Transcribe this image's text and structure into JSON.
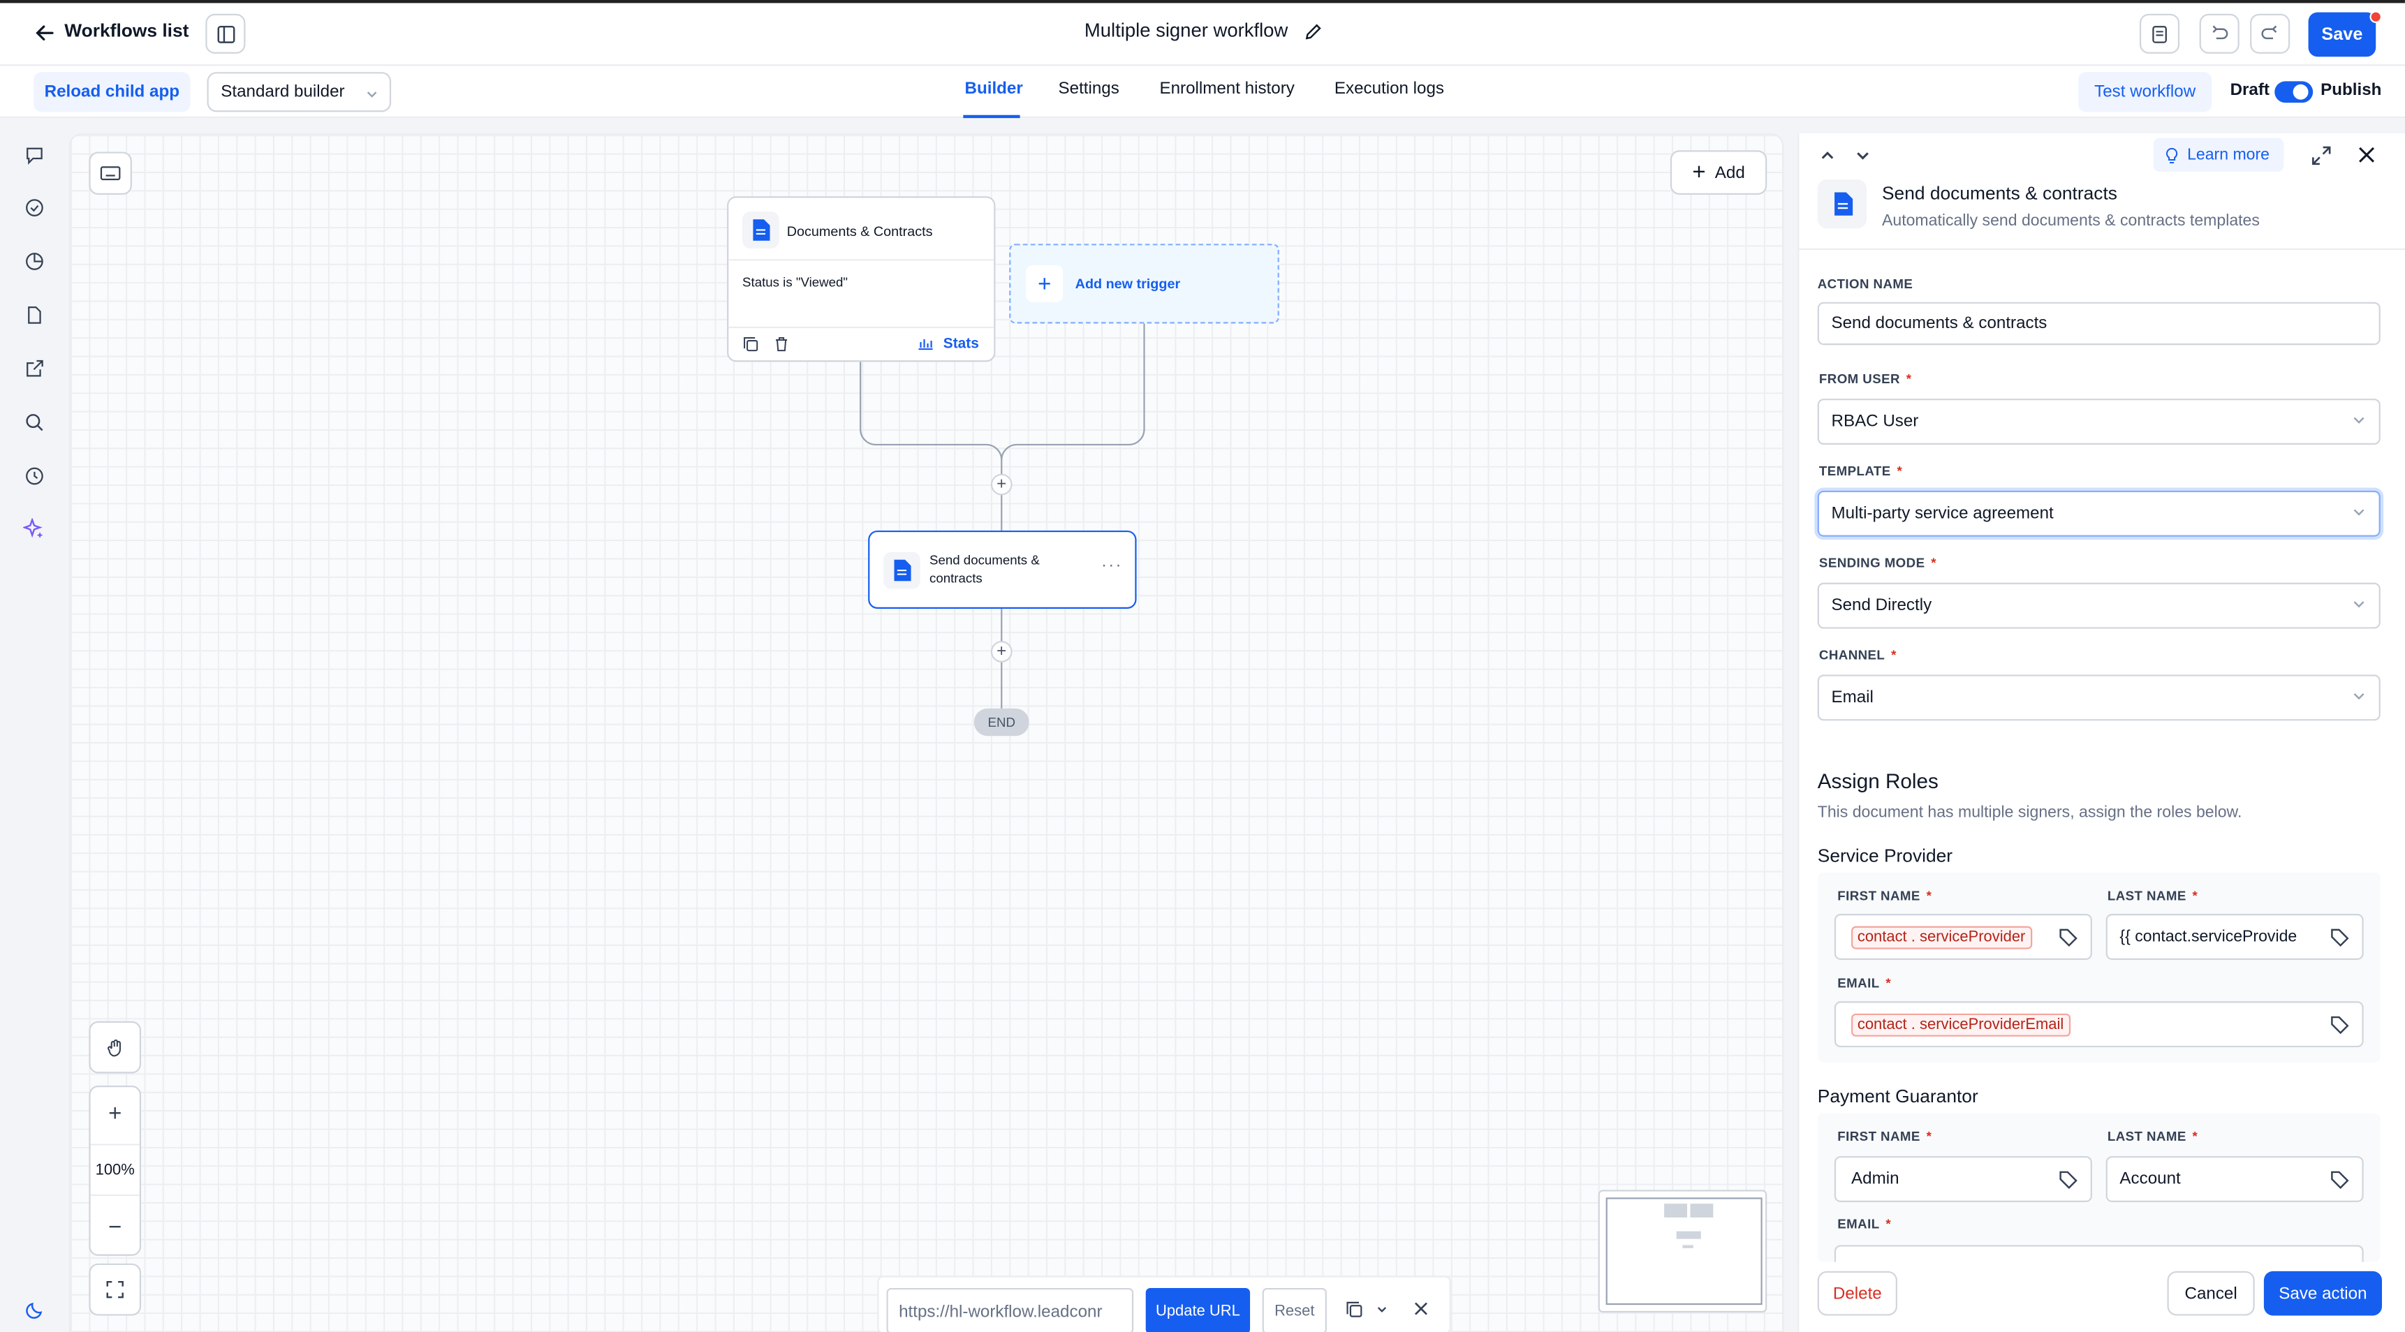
{
  "header": {
    "back_label": "Workflows list",
    "title": "Multiple signer workflow",
    "save_label": "Save"
  },
  "subbar": {
    "reload_label": "Reload child app",
    "builder_select": "Standard builder",
    "tabs": [
      "Builder",
      "Settings",
      "Enrollment history",
      "Execution logs"
    ],
    "test_label": "Test workflow",
    "draft_label": "Draft",
    "publish_label": "Publish"
  },
  "canvas": {
    "add_label": "Add",
    "trigger": {
      "title": "Documents & Contracts",
      "condition": "Status is \"Viewed\"",
      "stats_label": "Stats"
    },
    "add_trigger_label": "Add new trigger",
    "action_node": {
      "title_line1": "Send documents &",
      "title_line2": "contracts"
    },
    "end_label": "END",
    "zoom_level": "100%"
  },
  "url_bar": {
    "url_value": "https://hl-workflow.leadconr",
    "update_label": "Update URL",
    "reset_label": "Reset"
  },
  "panel": {
    "learn_more": "Learn more",
    "title": "Send documents & contracts",
    "subtitle": "Automatically send documents & contracts templates",
    "action_name_label": "ACTION NAME",
    "action_name_value": "Send documents & contracts",
    "from_user_label": "FROM USER",
    "from_user_value": "RBAC User",
    "template_label": "TEMPLATE",
    "template_value": "Multi-party service agreement",
    "sending_mode_label": "SENDING MODE",
    "sending_mode_value": "Send Directly",
    "channel_label": "CHANNEL",
    "channel_value": "Email",
    "assign_title": "Assign Roles",
    "assign_desc": "This document has multiple signers, assign the roles below.",
    "role1": {
      "title": "Service Provider",
      "first_label": "FIRST NAME",
      "first_chip_a": "contact",
      "first_chip_b": "serviceProvider",
      "last_label": "LAST NAME",
      "last_value": "{{ contact.serviceProvide",
      "email_label": "EMAIL",
      "email_chip_a": "contact",
      "email_chip_b": "serviceProviderEmail"
    },
    "role2": {
      "title": "Payment Guarantor",
      "first_label": "FIRST NAME",
      "first_value": "Admin",
      "last_label": "LAST NAME",
      "last_value": "Account",
      "email_label": "EMAIL"
    },
    "delete_label": "Delete",
    "cancel_label": "Cancel",
    "save_action_label": "Save action"
  },
  "colors": {
    "accent": "#155eef",
    "danger": "#d92d20"
  }
}
